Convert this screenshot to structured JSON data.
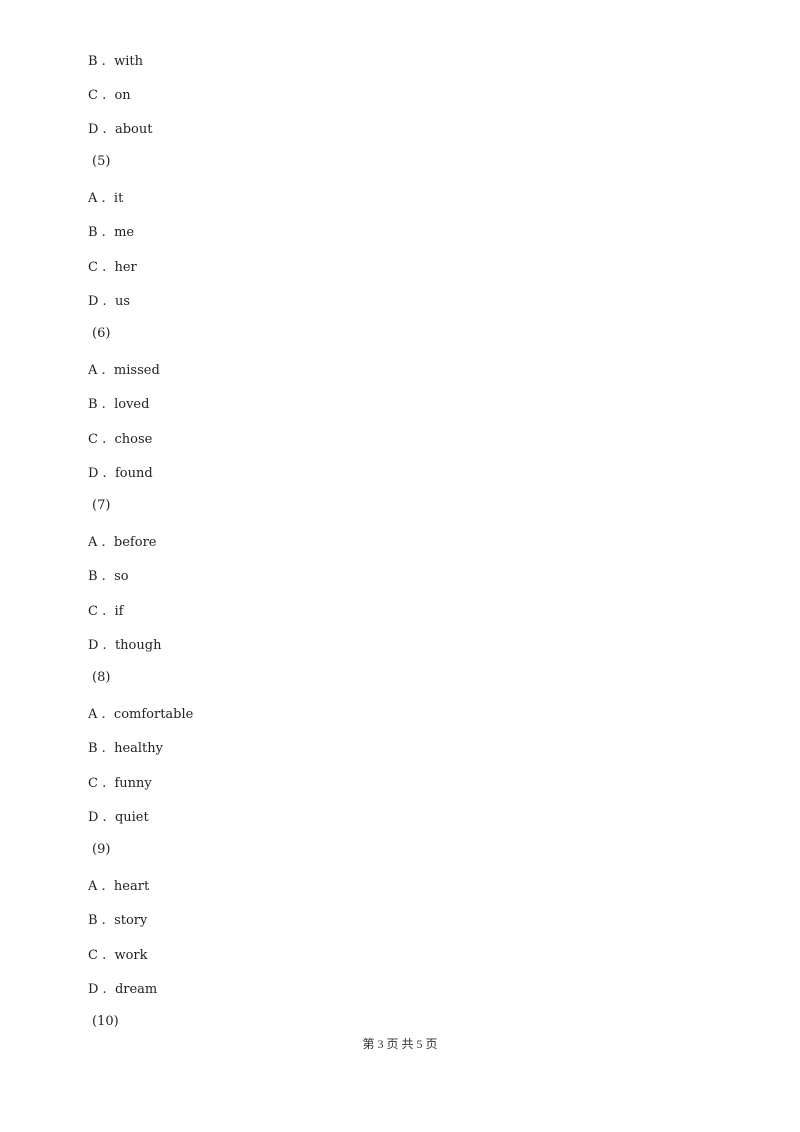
{
  "lines": [
    {
      "type": "option",
      "letter": "B",
      "text": "with"
    },
    {
      "type": "option",
      "letter": "C",
      "text": "on"
    },
    {
      "type": "option",
      "letter": "D",
      "text": "about"
    },
    {
      "type": "question",
      "text": "(5)"
    },
    {
      "type": "option",
      "letter": "A",
      "text": "it"
    },
    {
      "type": "option",
      "letter": "B",
      "text": "me"
    },
    {
      "type": "option",
      "letter": "C",
      "text": "her"
    },
    {
      "type": "option",
      "letter": "D",
      "text": "us"
    },
    {
      "type": "question",
      "text": "(6)"
    },
    {
      "type": "option",
      "letter": "A",
      "text": "missed"
    },
    {
      "type": "option",
      "letter": "B",
      "text": "loved"
    },
    {
      "type": "option",
      "letter": "C",
      "text": "chose"
    },
    {
      "type": "option",
      "letter": "D",
      "text": "found"
    },
    {
      "type": "question",
      "text": "(7)"
    },
    {
      "type": "option",
      "letter": "A",
      "text": "before"
    },
    {
      "type": "option",
      "letter": "B",
      "text": "so"
    },
    {
      "type": "option",
      "letter": "C",
      "text": "if"
    },
    {
      "type": "option",
      "letter": "D",
      "text": "though"
    },
    {
      "type": "question",
      "text": "(8)"
    },
    {
      "type": "option",
      "letter": "A",
      "text": "comfortable"
    },
    {
      "type": "option",
      "letter": "B",
      "text": "healthy"
    },
    {
      "type": "option",
      "letter": "C",
      "text": "funny"
    },
    {
      "type": "option",
      "letter": "D",
      "text": "quiet"
    },
    {
      "type": "question",
      "text": "(9)"
    },
    {
      "type": "option",
      "letter": "A",
      "text": "heart"
    },
    {
      "type": "option",
      "letter": "B",
      "text": "story"
    },
    {
      "type": "option",
      "letter": "C",
      "text": "work"
    },
    {
      "type": "option",
      "letter": "D",
      "text": "dream"
    },
    {
      "type": "question",
      "text": "(10)"
    }
  ],
  "footer": {
    "text": "第 3 页 共 5 页"
  }
}
